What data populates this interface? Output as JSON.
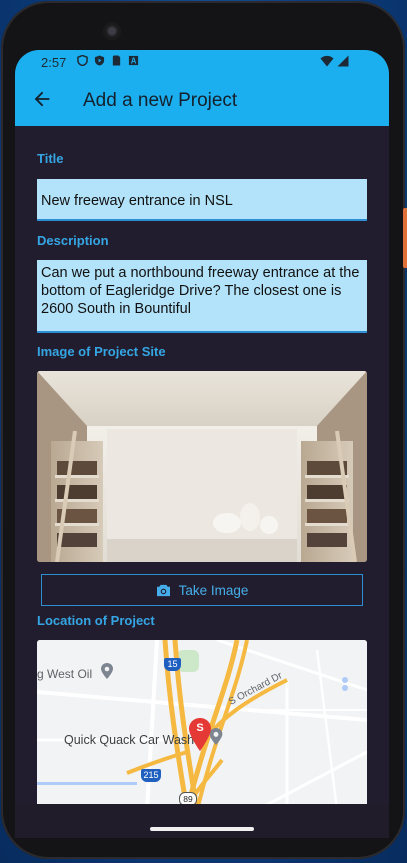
{
  "status": {
    "time": "2:57",
    "left_icons": [
      "shield-icon",
      "play-protect-icon",
      "sim-card-icon",
      "a-icon"
    ],
    "right_icons": [
      "wifi-icon",
      "cellular-icon"
    ]
  },
  "appbar": {
    "title": "Add a new Project",
    "back_icon": "arrow-back-icon"
  },
  "form": {
    "title_label": "Title",
    "title_value": "New freeway entrance in NSL",
    "description_label": "Description",
    "description_value": "Can we put a northbound freeway entrance at the bottom of Eagleridge Drive? The closest one is 2600 South in Bountiful",
    "image_label": "Image of Project Site",
    "take_image_label": "Take Image",
    "location_label": "Location of Project"
  },
  "map": {
    "places": [
      "g West Oil",
      "Quick Quack Car Wash",
      "S Orchard Dr"
    ],
    "highway_shields": [
      "15",
      "215",
      "89"
    ],
    "pin_letter": "S"
  },
  "colors": {
    "accent": "#1caff0",
    "background": "#221d2e",
    "label": "#35a6e4",
    "field": "#b3e3fb"
  }
}
